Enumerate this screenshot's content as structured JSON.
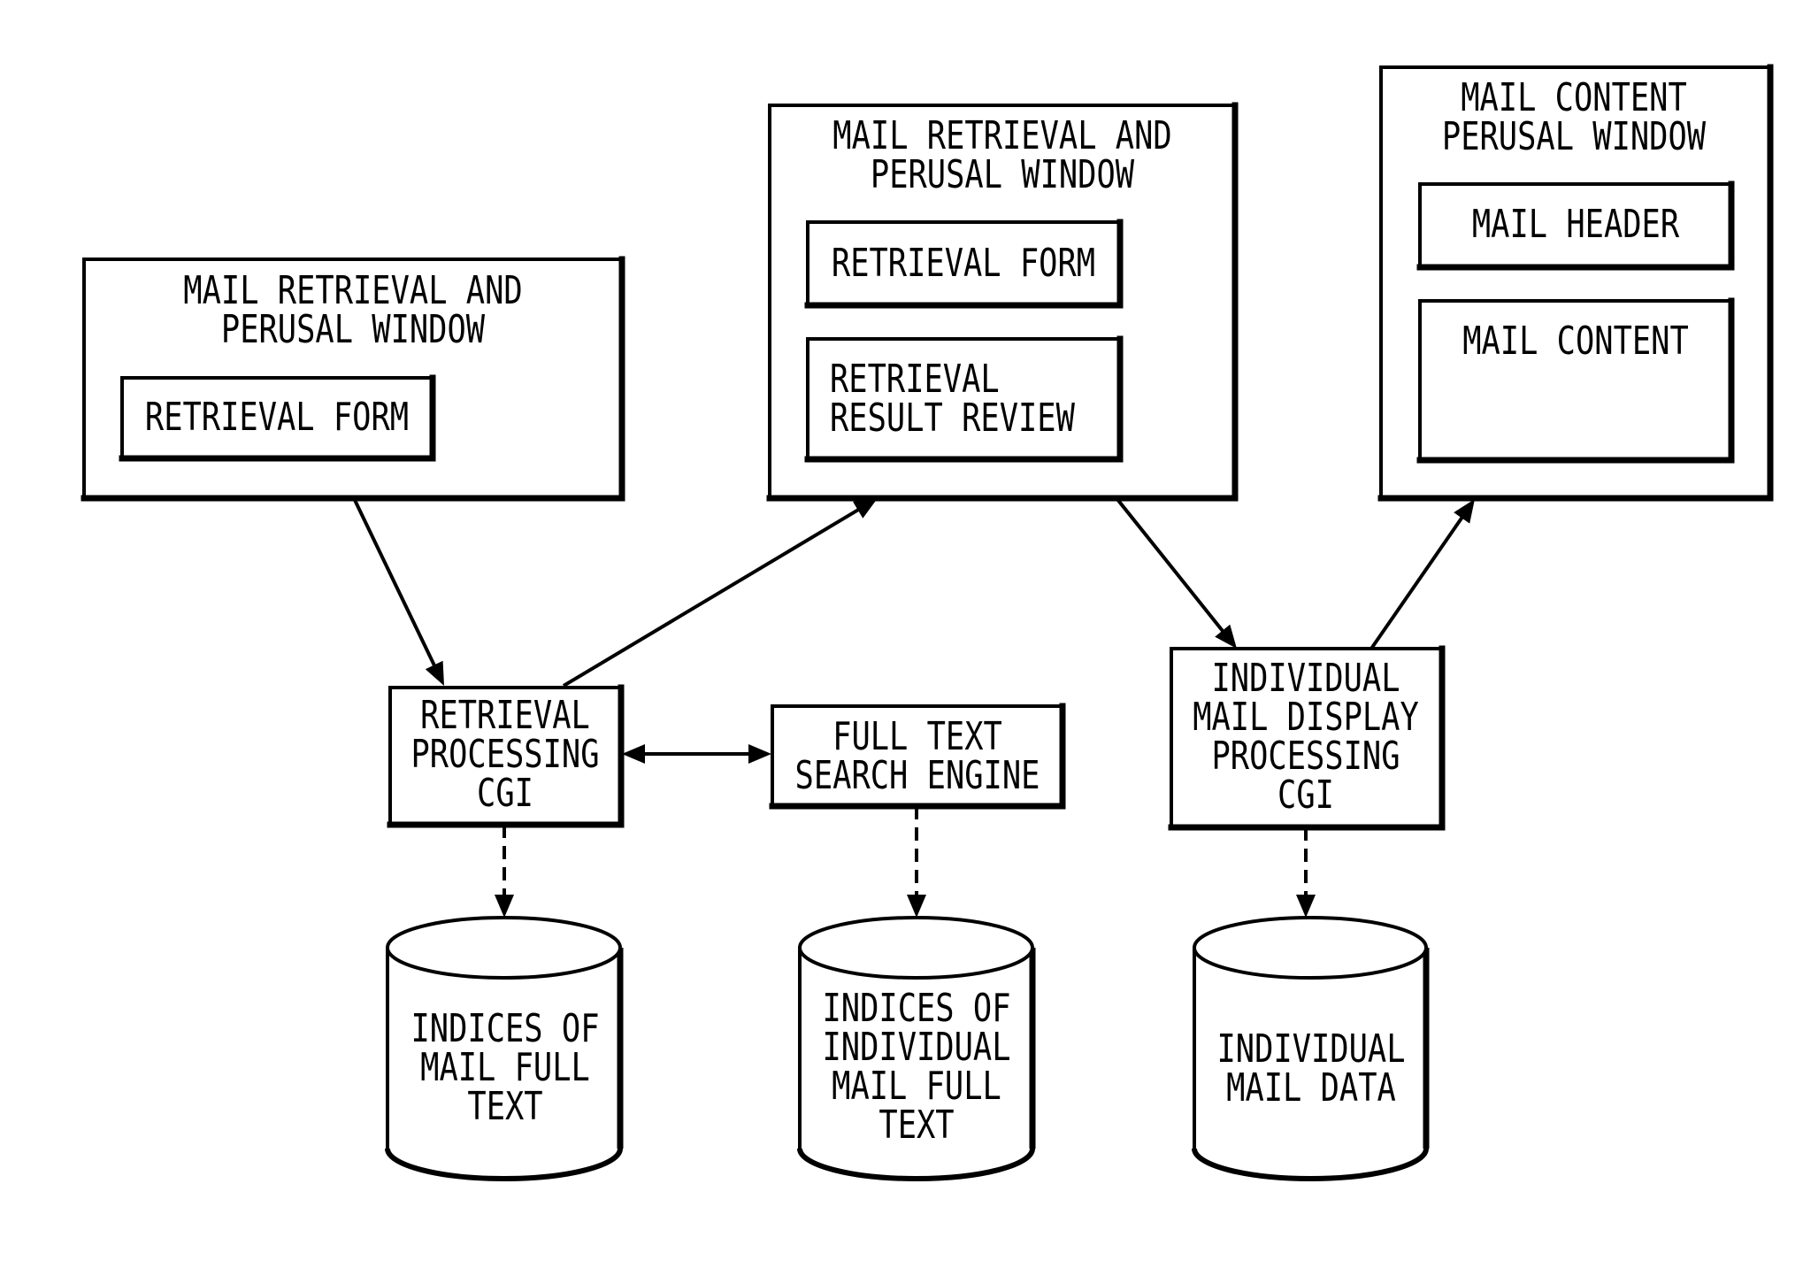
{
  "diagram": {
    "colors": {
      "ink": "#000000",
      "background": "#ffffff"
    },
    "nodes": {
      "window_a": {
        "title": [
          "MAIL RETRIEVAL AND",
          "PERUSAL WINDOW"
        ],
        "retrieval_form": [
          "RETRIEVAL FORM"
        ]
      },
      "window_b": {
        "title": [
          "MAIL RETRIEVAL AND",
          "PERUSAL WINDOW"
        ],
        "retrieval_form": [
          "RETRIEVAL FORM"
        ],
        "result_review": [
          "RETRIEVAL",
          "RESULT REVIEW"
        ]
      },
      "window_c": {
        "title": [
          "MAIL CONTENT",
          "PERUSAL WINDOW"
        ],
        "mail_header": [
          "MAIL HEADER"
        ],
        "mail_content": [
          "MAIL CONTENT"
        ]
      },
      "retrieval_cgi": {
        "label": [
          "RETRIEVAL",
          "PROCESSING",
          "CGI"
        ]
      },
      "search_engine": {
        "label": [
          "FULL TEXT",
          "SEARCH ENGINE"
        ]
      },
      "display_cgi": {
        "label": [
          "INDIVIDUAL",
          "MAIL DISPLAY",
          "PROCESSING",
          "CGI"
        ]
      },
      "db_mail_index": {
        "label": [
          "INDICES OF",
          "MAIL FULL",
          "TEXT"
        ]
      },
      "db_individual_index": {
        "label": [
          "INDICES OF",
          "INDIVIDUAL",
          "MAIL FULL",
          "TEXT"
        ]
      },
      "db_mail_data": {
        "label": [
          "INDIVIDUAL",
          "MAIL DATA"
        ]
      }
    },
    "edges": [
      {
        "from": "window_a",
        "to": "retrieval_cgi",
        "style": "solid",
        "heads": "end"
      },
      {
        "from": "retrieval_cgi",
        "to": "window_b",
        "style": "solid",
        "heads": "end"
      },
      {
        "from": "retrieval_cgi",
        "to": "search_engine",
        "style": "solid",
        "heads": "both"
      },
      {
        "from": "window_b",
        "to": "display_cgi",
        "style": "solid",
        "heads": "end"
      },
      {
        "from": "display_cgi",
        "to": "window_c",
        "style": "solid",
        "heads": "end"
      },
      {
        "from": "retrieval_cgi",
        "to": "db_mail_index",
        "style": "dashed",
        "heads": "end"
      },
      {
        "from": "search_engine",
        "to": "db_individual_index",
        "style": "dashed",
        "heads": "end"
      },
      {
        "from": "display_cgi",
        "to": "db_mail_data",
        "style": "dashed",
        "heads": "end"
      }
    ]
  }
}
